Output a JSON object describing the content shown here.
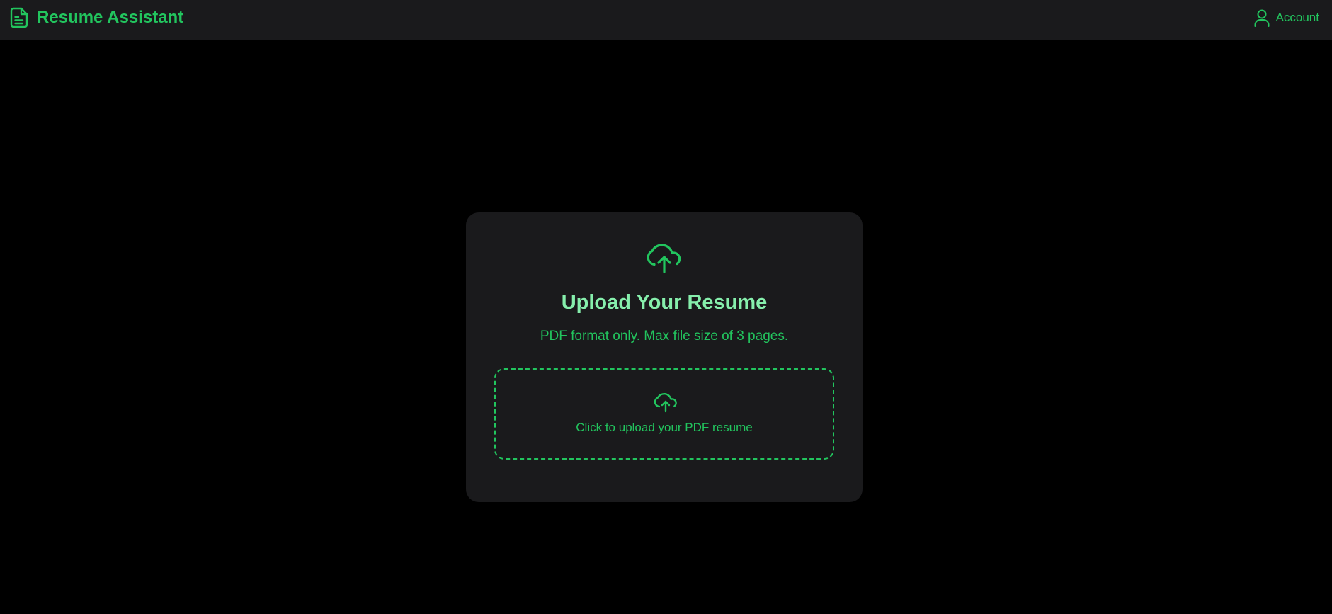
{
  "header": {
    "app_title": "Resume Assistant",
    "app_icon": "file-text-icon",
    "account_label": "Account",
    "account_icon": "user-icon"
  },
  "upload_card": {
    "icon": "cloud-upload-icon",
    "title": "Upload Your Resume",
    "subtitle": "PDF format only. Max file size of 3 pages.",
    "dropzone": {
      "icon": "cloud-upload-icon",
      "label": "Click to upload your PDF resume"
    }
  },
  "colors": {
    "background": "#000000",
    "surface": "#1a1a1c",
    "accent": "#22c55e",
    "title_accent": "#86efac"
  }
}
